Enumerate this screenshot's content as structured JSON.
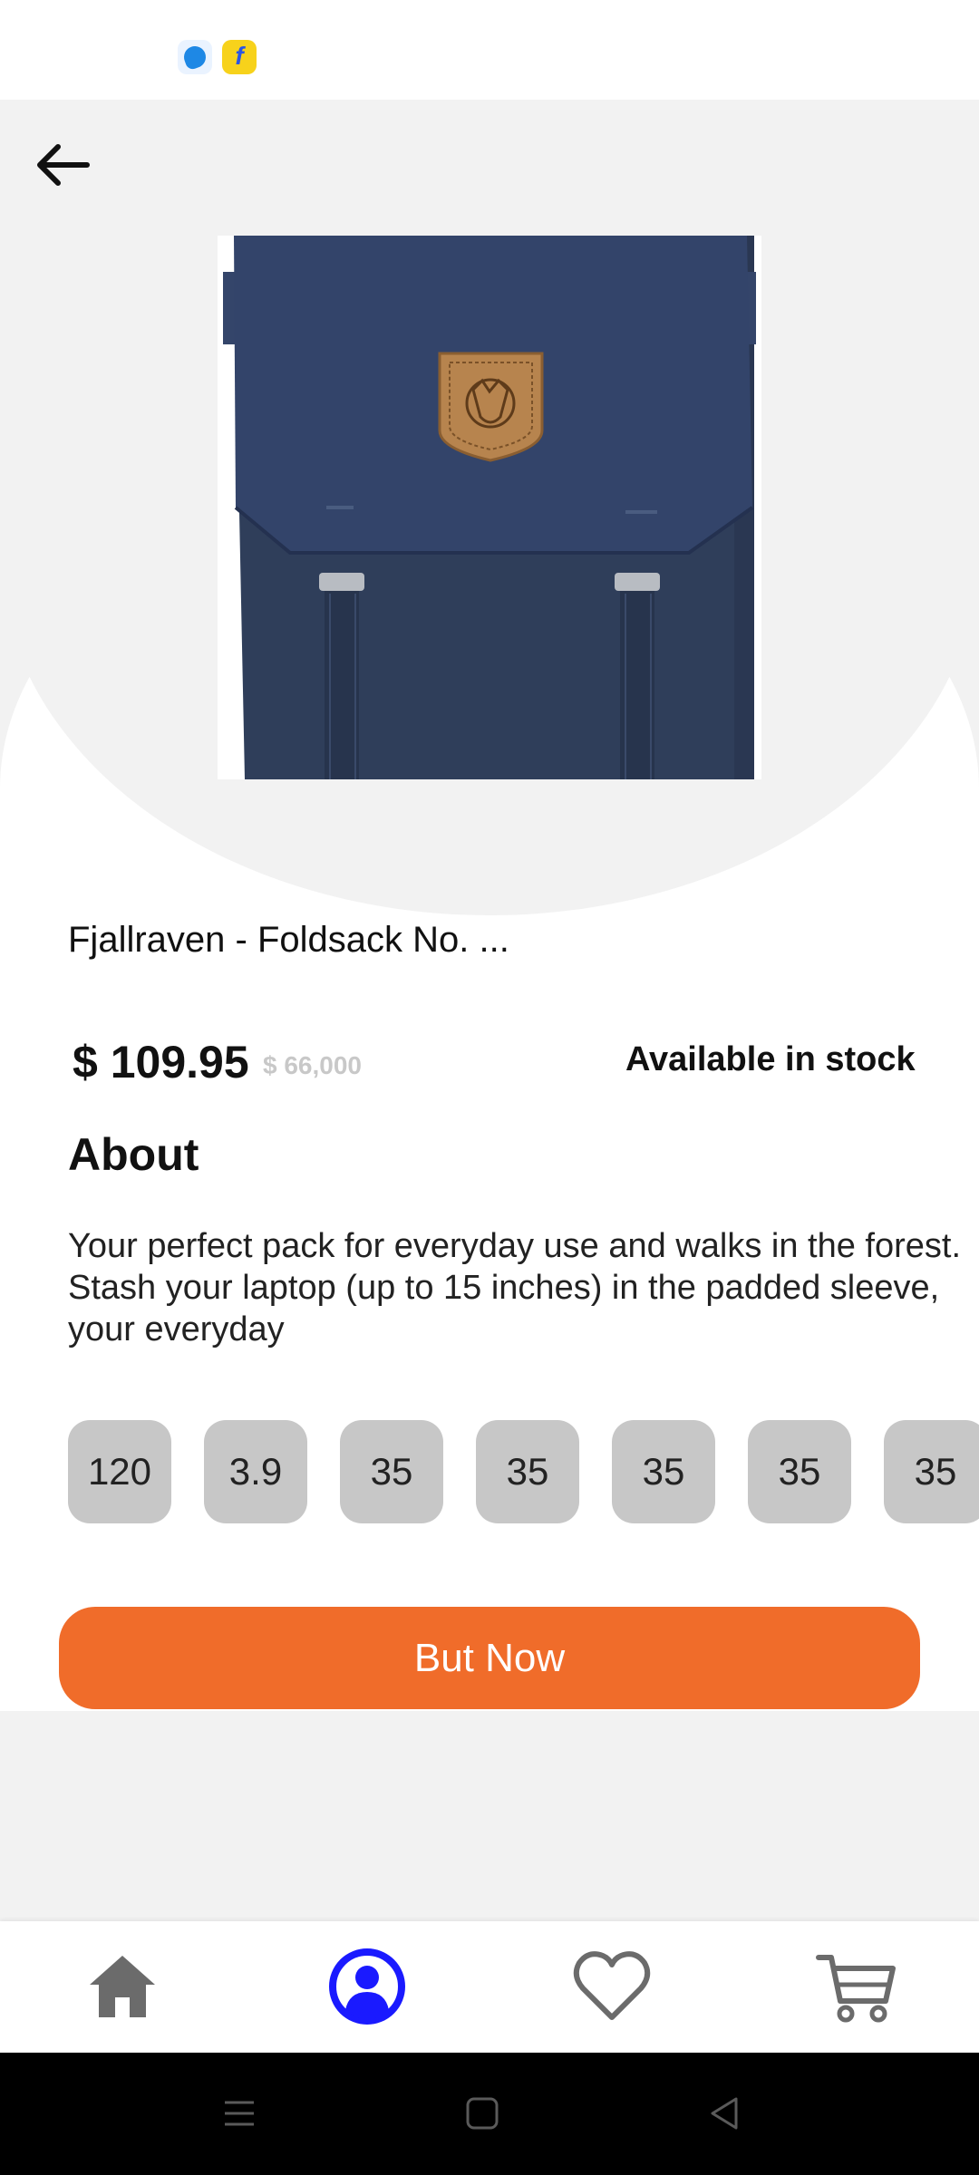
{
  "status_bar": {
    "icons": [
      "notification-app-icon",
      "flipkart-icon"
    ],
    "flipkart_glyph": "f"
  },
  "header": {
    "back_icon": "arrow-left-icon"
  },
  "product": {
    "title": "Fjallraven - Foldsack No.  ...",
    "price": "$ 109.95",
    "old_price": "$ 66,000",
    "stock_status": "Available in stock",
    "about_heading": "About",
    "description": "Your perfect pack for everyday use and walks in the forest. Stash your laptop (up to 15 inches) in the padded sleeve, your everyday",
    "options": [
      "120",
      "3.9",
      "35",
      "35",
      "35",
      "35",
      "35"
    ]
  },
  "actions": {
    "buy_label": "But Now"
  },
  "bottom_nav": {
    "items": [
      {
        "name": "home",
        "icon": "home-icon"
      },
      {
        "name": "profile",
        "icon": "user-icon",
        "active": true
      },
      {
        "name": "favorites",
        "icon": "heart-icon"
      },
      {
        "name": "cart",
        "icon": "cart-icon"
      }
    ]
  },
  "system_nav": {
    "buttons": [
      "menu-icon",
      "home-square-icon",
      "back-triangle-icon"
    ]
  },
  "colors": {
    "accent": "#f06c2a",
    "active_nav": "#1a1aff",
    "chip_bg": "#c7c7c7",
    "surface_gray": "#f2f2f2",
    "backpack": "#2d3d58"
  }
}
